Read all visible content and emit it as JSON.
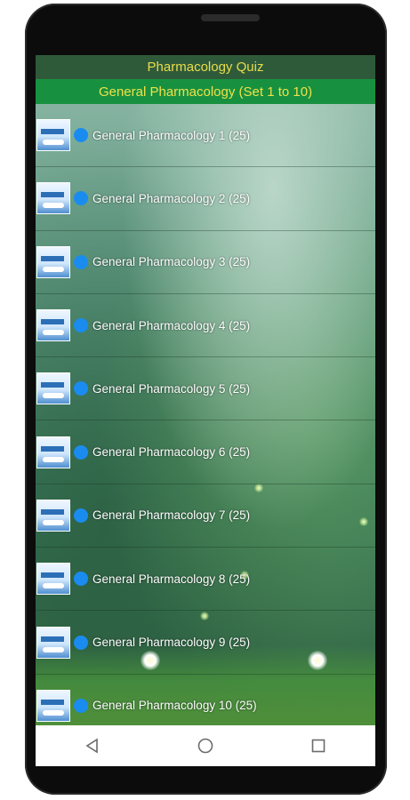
{
  "app": {
    "title": "Pharmacology Quiz",
    "section_title": "General Pharmacology (Set 1 to 10)"
  },
  "quiz_sets": [
    {
      "label": "General Pharmacology 1 (25)"
    },
    {
      "label": "General Pharmacology 2 (25)"
    },
    {
      "label": "General Pharmacology 3 (25)"
    },
    {
      "label": "General Pharmacology 4 (25)"
    },
    {
      "label": "General Pharmacology 5 (25)"
    },
    {
      "label": "General Pharmacology 6 (25)"
    },
    {
      "label": "General Pharmacology 7 (25)"
    },
    {
      "label": "General Pharmacology 8 (25)"
    },
    {
      "label": "General Pharmacology 9 (25)"
    },
    {
      "label": "General Pharmacology 10 (25)"
    }
  ],
  "navigation": {
    "icons": [
      "back-icon",
      "home-icon",
      "recents-icon"
    ]
  },
  "colors": {
    "title_text": "#e8dd4a",
    "section_bar": "#17913f",
    "bullet": "#1a8cf0"
  }
}
